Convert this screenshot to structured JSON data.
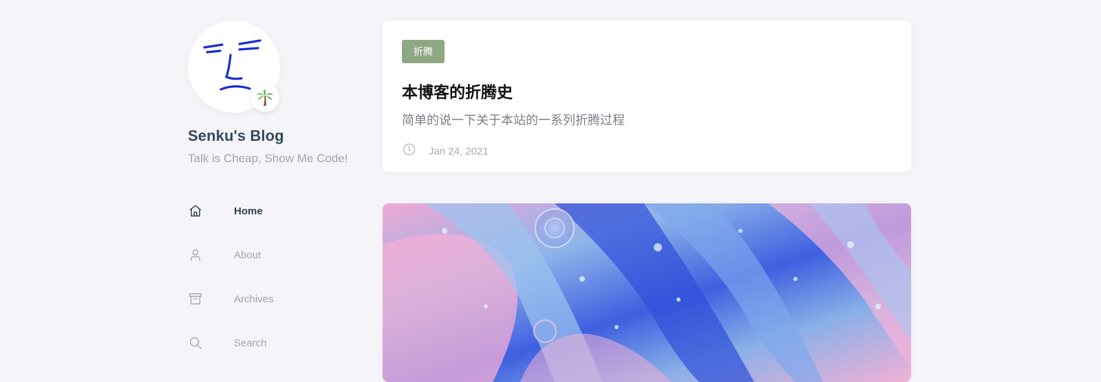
{
  "site": {
    "title": "Senku's Blog",
    "subtitle": "Talk is Cheap, Show Me Code!",
    "avatar_icon": "face-doodle-avatar",
    "status_emoji": "🌴"
  },
  "nav": {
    "items": [
      {
        "label": "Home",
        "icon": "home-icon",
        "active": true
      },
      {
        "label": "About",
        "icon": "user-icon",
        "active": false
      },
      {
        "label": "Archives",
        "icon": "archive-icon",
        "active": false
      },
      {
        "label": "Search",
        "icon": "search-icon",
        "active": false
      }
    ]
  },
  "posts": [
    {
      "tag": "折腾",
      "title": "本博客的折腾史",
      "description": "简单的说一下关于本站的一系列折腾过程",
      "date": "Jan 24, 2021"
    }
  ],
  "colors": {
    "background": "#f5f5f9",
    "tag_bg": "#8fa884",
    "active_nav": "#2c3e50",
    "muted_text": "#a0a5ab",
    "avatar_ink": "#1a2bd6"
  }
}
